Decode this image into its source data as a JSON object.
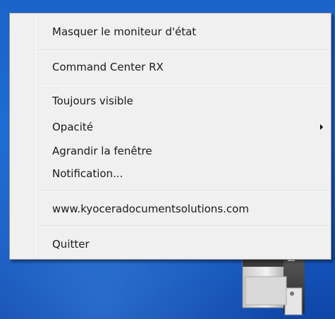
{
  "context_menu": {
    "items": [
      {
        "label": "Masquer le moniteur d'état"
      },
      {
        "label": "Command Center RX"
      },
      {
        "label": "Toujours visible"
      },
      {
        "label": "Opacité",
        "has_submenu": true
      },
      {
        "label": "Agrandir la fenêtre"
      },
      {
        "label": "Notification..."
      },
      {
        "label": "www.kyoceradocumentsolutions.com"
      },
      {
        "label": "Quitter"
      }
    ]
  },
  "colors": {
    "menu_background": "#f0f0f0",
    "menu_border": "#979797",
    "desktop_blue": "#1c6bd4"
  },
  "icons": {
    "submenu_arrow": "chevron-right-icon",
    "device": "printer-icon"
  }
}
